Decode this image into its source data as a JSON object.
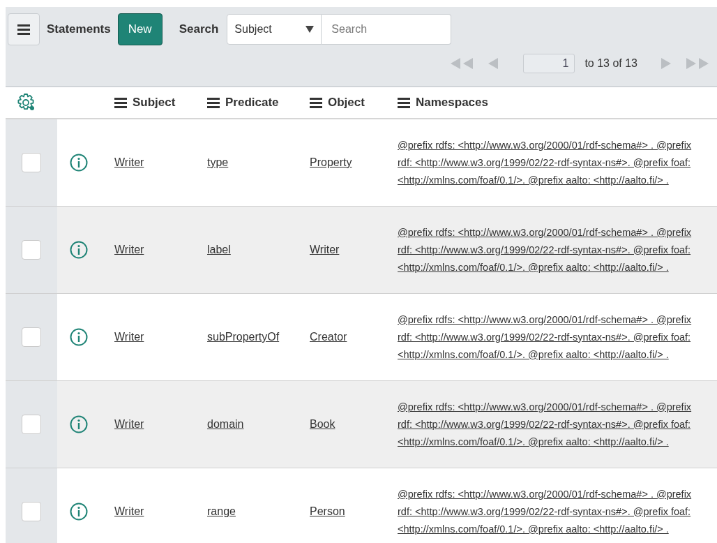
{
  "toolbar": {
    "title": "Statements",
    "new_button": "New",
    "search_label": "Search",
    "search_field": {
      "value": "Subject",
      "placeholder": "Search"
    }
  },
  "pagination": {
    "page": "1",
    "range": "to 13 of 13",
    "first_disabled": true,
    "prev_disabled": true,
    "next_disabled": true,
    "last_disabled": true
  },
  "table": {
    "columns": [
      "Subject",
      "Predicate",
      "Object",
      "Namespaces"
    ],
    "rows": [
      {
        "selected": false,
        "subject": "Writer",
        "predicate": "type",
        "object": "Property",
        "namespaces": "@prefix rdfs: <http://www.w3.org/2000/01/rdf-schema#> . @prefix rdf: <http://www.w3.org/1999/02/22-rdf-syntax-ns#>. @prefix foaf: <http://xmlns.com/foaf/0.1/>. @prefix aalto: <http://aalto.fi/> ."
      },
      {
        "selected": false,
        "subject": "Writer",
        "predicate": "label",
        "object": "Writer",
        "namespaces": "@prefix rdfs: <http://www.w3.org/2000/01/rdf-schema#> . @prefix rdf: <http://www.w3.org/1999/02/22-rdf-syntax-ns#>. @prefix foaf: <http://xmlns.com/foaf/0.1/>. @prefix aalto: <http://aalto.fi/> ."
      },
      {
        "selected": false,
        "subject": "Writer",
        "predicate": "subPropertyOf",
        "object": "Creator",
        "namespaces": "@prefix rdfs: <http://www.w3.org/2000/01/rdf-schema#> . @prefix rdf: <http://www.w3.org/1999/02/22-rdf-syntax-ns#>. @prefix foaf: <http://xmlns.com/foaf/0.1/>. @prefix aalto: <http://aalto.fi/> ."
      },
      {
        "selected": false,
        "subject": "Writer",
        "predicate": "domain",
        "object": "Book",
        "namespaces": "@prefix rdfs: <http://www.w3.org/2000/01/rdf-schema#> . @prefix rdf: <http://www.w3.org/1999/02/22-rdf-syntax-ns#>. @prefix foaf: <http://xmlns.com/foaf/0.1/>. @prefix aalto: <http://aalto.fi/> ."
      },
      {
        "selected": false,
        "subject": "Writer",
        "predicate": "range",
        "object": "Person",
        "namespaces": "@prefix rdfs: <http://www.w3.org/2000/01/rdf-schema#> . @prefix rdf: <http://www.w3.org/1999/02/22-rdf-syntax-ns#>. @prefix foaf: <http://xmlns.com/foaf/0.1/>. @prefix aalto: <http://aalto.fi/> ."
      }
    ]
  }
}
